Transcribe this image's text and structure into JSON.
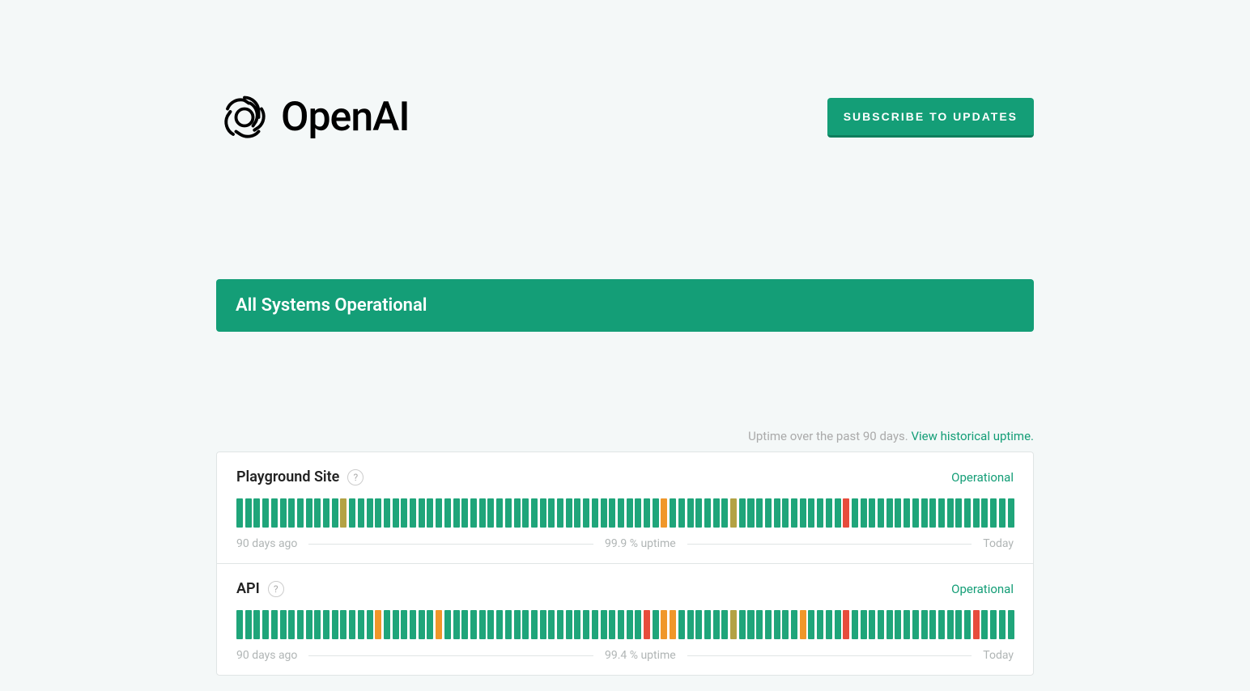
{
  "header": {
    "brand": "OpenAI",
    "subscribe_label": "SUBSCRIBE TO UPDATES"
  },
  "status_banner": "All Systems Operational",
  "uptime_header": {
    "lead_text": "Uptime over the past 90 days. ",
    "link_text": "View historical uptime."
  },
  "footer_labels": {
    "left": "90 days ago",
    "right": "Today"
  },
  "components": [
    {
      "name": "Playground Site",
      "status": "Operational",
      "uptime_text": "99.9 % uptime",
      "bars": [
        "green",
        "green",
        "green",
        "green",
        "green",
        "green",
        "green",
        "green",
        "green",
        "green",
        "green",
        "green",
        "yellow",
        "green",
        "green",
        "green",
        "green",
        "green",
        "green",
        "green",
        "green",
        "green",
        "green",
        "green",
        "green",
        "green",
        "green",
        "green",
        "green",
        "green",
        "green",
        "green",
        "green",
        "green",
        "green",
        "green",
        "green",
        "green",
        "green",
        "green",
        "green",
        "green",
        "green",
        "green",
        "green",
        "green",
        "green",
        "green",
        "green",
        "orange",
        "green",
        "green",
        "green",
        "green",
        "green",
        "green",
        "green",
        "yellow",
        "green",
        "green",
        "green",
        "green",
        "green",
        "green",
        "green",
        "green",
        "green",
        "green",
        "green",
        "green",
        "red",
        "green",
        "green",
        "green",
        "green",
        "green",
        "green",
        "green",
        "green",
        "green",
        "green",
        "green",
        "green",
        "green",
        "green",
        "green",
        "green",
        "green",
        "green",
        "green"
      ]
    },
    {
      "name": "API",
      "status": "Operational",
      "uptime_text": "99.4 % uptime",
      "bars": [
        "green",
        "green",
        "green",
        "green",
        "green",
        "green",
        "green",
        "green",
        "green",
        "green",
        "green",
        "green",
        "green",
        "green",
        "green",
        "green",
        "orange",
        "green",
        "green",
        "green",
        "green",
        "green",
        "green",
        "orange",
        "green",
        "green",
        "green",
        "green",
        "green",
        "green",
        "green",
        "green",
        "green",
        "green",
        "green",
        "green",
        "green",
        "green",
        "green",
        "green",
        "green",
        "green",
        "green",
        "green",
        "green",
        "green",
        "green",
        "red",
        "green",
        "orange",
        "orange",
        "green",
        "green",
        "green",
        "green",
        "green",
        "green",
        "yellow",
        "green",
        "green",
        "green",
        "green",
        "green",
        "green",
        "green",
        "orange",
        "green",
        "green",
        "green",
        "green",
        "red",
        "green",
        "green",
        "green",
        "green",
        "green",
        "green",
        "green",
        "green",
        "green",
        "green",
        "green",
        "green",
        "green",
        "green",
        "red",
        "green",
        "green",
        "green",
        "green"
      ]
    }
  ]
}
